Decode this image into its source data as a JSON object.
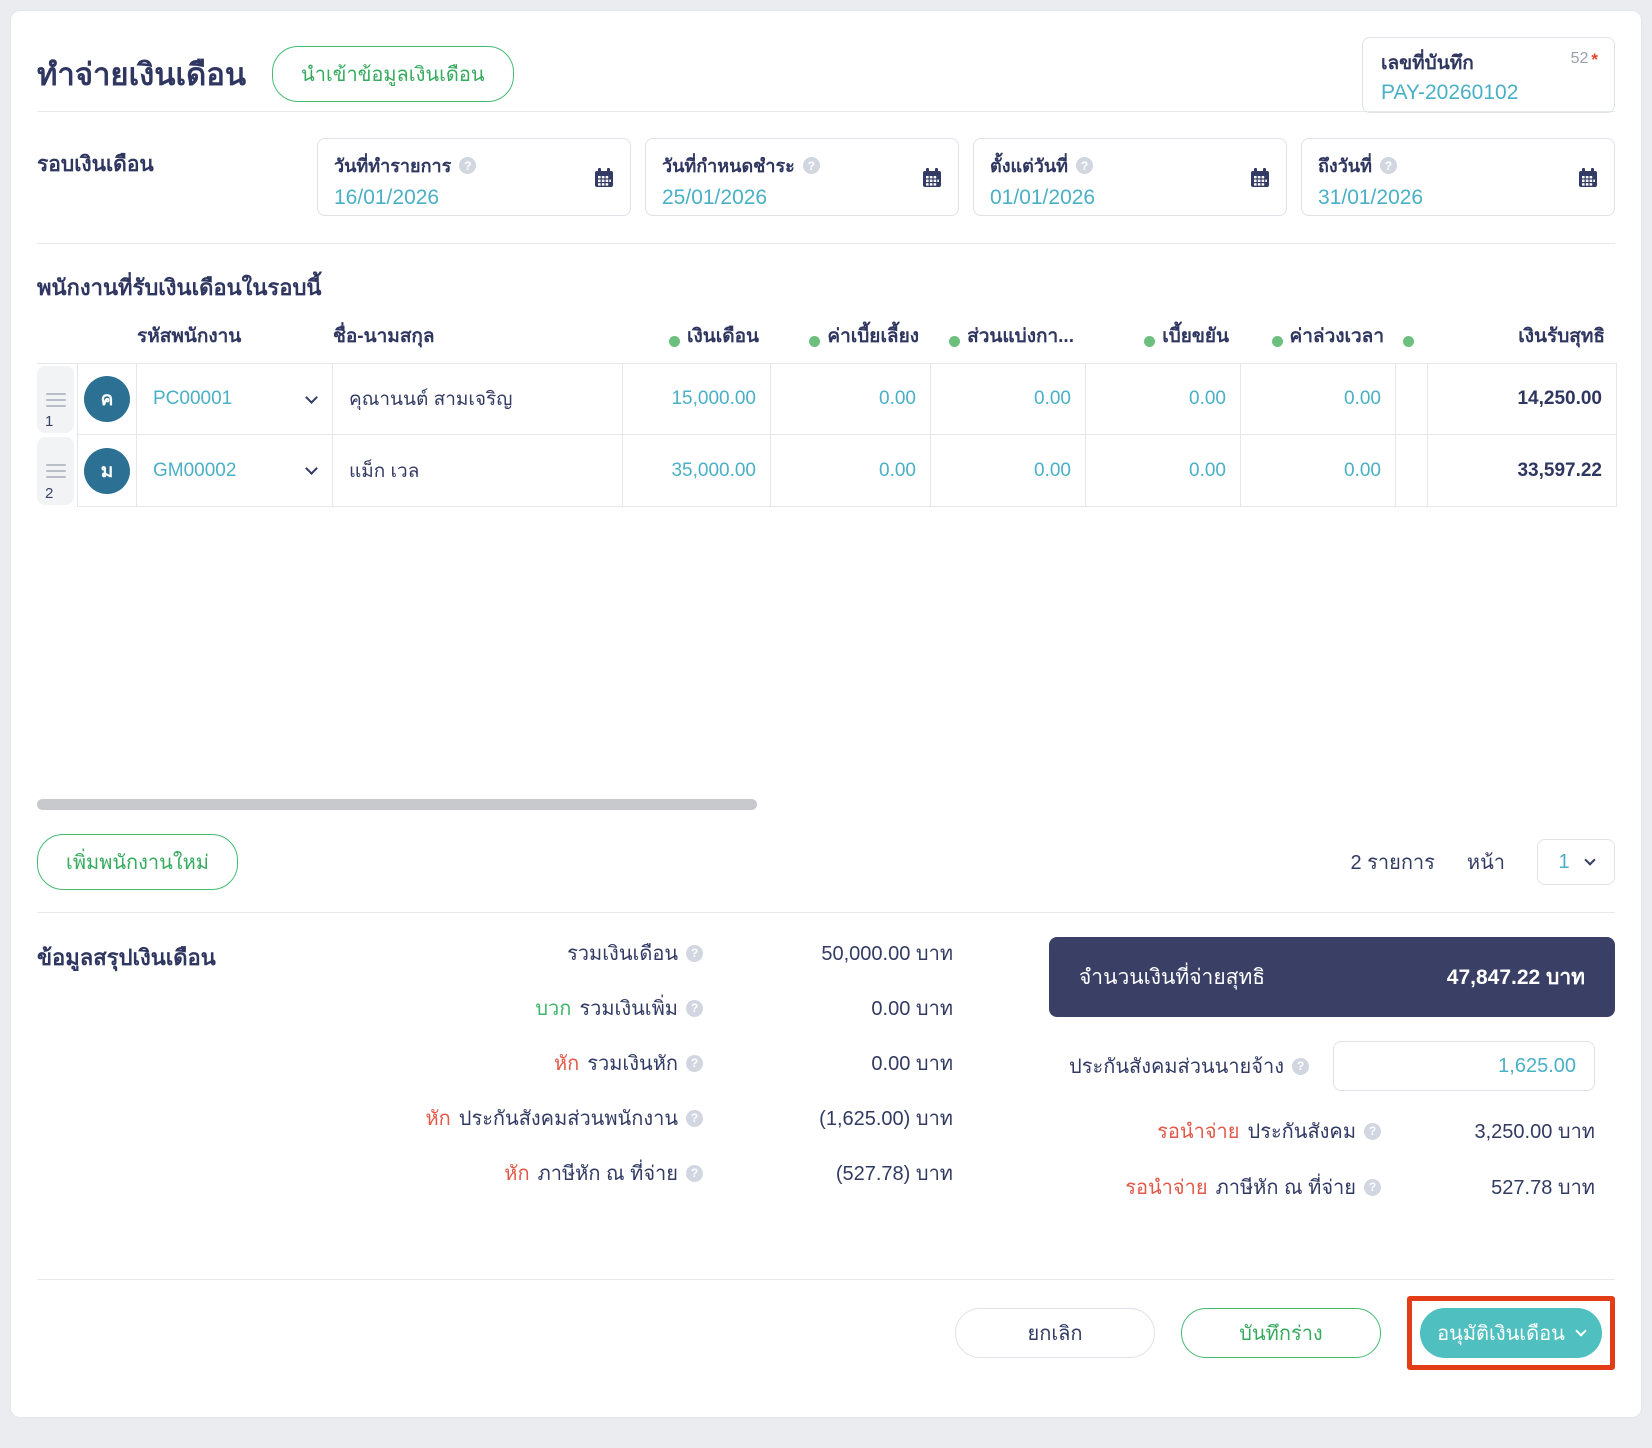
{
  "colors": {
    "accent_teal": "#4ab0c6",
    "green": "#35ab5e",
    "green_dot": "#6cbf7d",
    "red": "#e15948",
    "navy": "#323a63",
    "net_box_bg": "#3a3f66",
    "approve_button_bg": "#4fbfc0",
    "annotation_red": "#e23d17",
    "avatar_bg": "#2c7093"
  },
  "header": {
    "title": "ทำจ่ายเงินเดือน",
    "import_button": "นำเข้าข้อมูลเงินเดือน",
    "record": {
      "label": "เลขที่บันทึก",
      "badge": "52",
      "required": "*",
      "value": "PAY-20260102"
    }
  },
  "period": {
    "label": "รอบเงินเดือน",
    "fields": [
      {
        "label": "วันที่ทำรายการ",
        "value": "16/01/2026"
      },
      {
        "label": "วันที่กำหนดชำระ",
        "value": "25/01/2026"
      },
      {
        "label": "ตั้งแต่วันที่",
        "value": "01/01/2026"
      },
      {
        "label": "ถึงวันที่",
        "value": "31/01/2026"
      }
    ]
  },
  "table": {
    "section_title": "พนักงานที่รับเงินเดือนในรอบนี้",
    "headers": {
      "code": "รหัสพนักงาน",
      "name": "ชื่อ-นามสกุล",
      "salary": "เงินเดือน",
      "allowance": "ค่าเบี้ยเลี้ยง",
      "share": "ส่วนแบ่งกา...",
      "diligence": "เบี้ยขยัน",
      "overtime": "ค่าล่วงเวลา",
      "net": "เงินรับสุทธิ"
    },
    "rows": [
      {
        "index": "1",
        "avatar": "ค",
        "code": "PC00001",
        "name": "คุณานนต์ สามเจริญ",
        "salary": "15,000.00",
        "allowance": "0.00",
        "share": "0.00",
        "diligence": "0.00",
        "overtime": "0.00",
        "net": "14,250.00"
      },
      {
        "index": "2",
        "avatar": "ม",
        "code": "GM00002",
        "name": "แม็ก เวล",
        "salary": "35,000.00",
        "allowance": "0.00",
        "share": "0.00",
        "diligence": "0.00",
        "overtime": "0.00",
        "net": "33,597.22"
      }
    ],
    "add_button": "เพิ่มพนักงานใหม่",
    "pagination": {
      "count": "2 รายการ",
      "page_label": "หน้า",
      "page": "1"
    }
  },
  "summary": {
    "section_title": "ข้อมูลสรุปเงินเดือน",
    "left_rows": [
      {
        "prefix": "",
        "label": "รวมเงินเดือน",
        "value": "50,000.00 บาท"
      },
      {
        "prefix": "บวก",
        "label": "รวมเงินเพิ่ม",
        "value": "0.00 บาท"
      },
      {
        "prefix": "หัก",
        "label": "รวมเงินหัก",
        "value": "0.00 บาท"
      },
      {
        "prefix": "หัก",
        "label": "ประกันสังคมส่วนพนักงาน",
        "value": "(1,625.00) บาท"
      },
      {
        "prefix": "หัก",
        "label": "ภาษีหัก ณ ที่จ่าย",
        "value": "(527.78) บาท"
      }
    ],
    "net_box": {
      "label": "จำนวนเงินที่จ่ายสุทธิ",
      "value": "47,847.22 บาท"
    },
    "employer_ssf": {
      "label": "ประกันสังคมส่วนนายจ้าง",
      "value": "1,625.00"
    },
    "pending_rows": [
      {
        "prefix": "รอนำจ่าย",
        "label": "ประกันสังคม",
        "value": "3,250.00 บาท"
      },
      {
        "prefix": "รอนำจ่าย",
        "label": "ภาษีหัก ณ ที่จ่าย",
        "value": "527.78 บาท"
      }
    ]
  },
  "footer": {
    "cancel": "ยกเลิก",
    "save_draft": "บันทึกร่าง",
    "approve": "อนุมัติเงินเดือน"
  }
}
